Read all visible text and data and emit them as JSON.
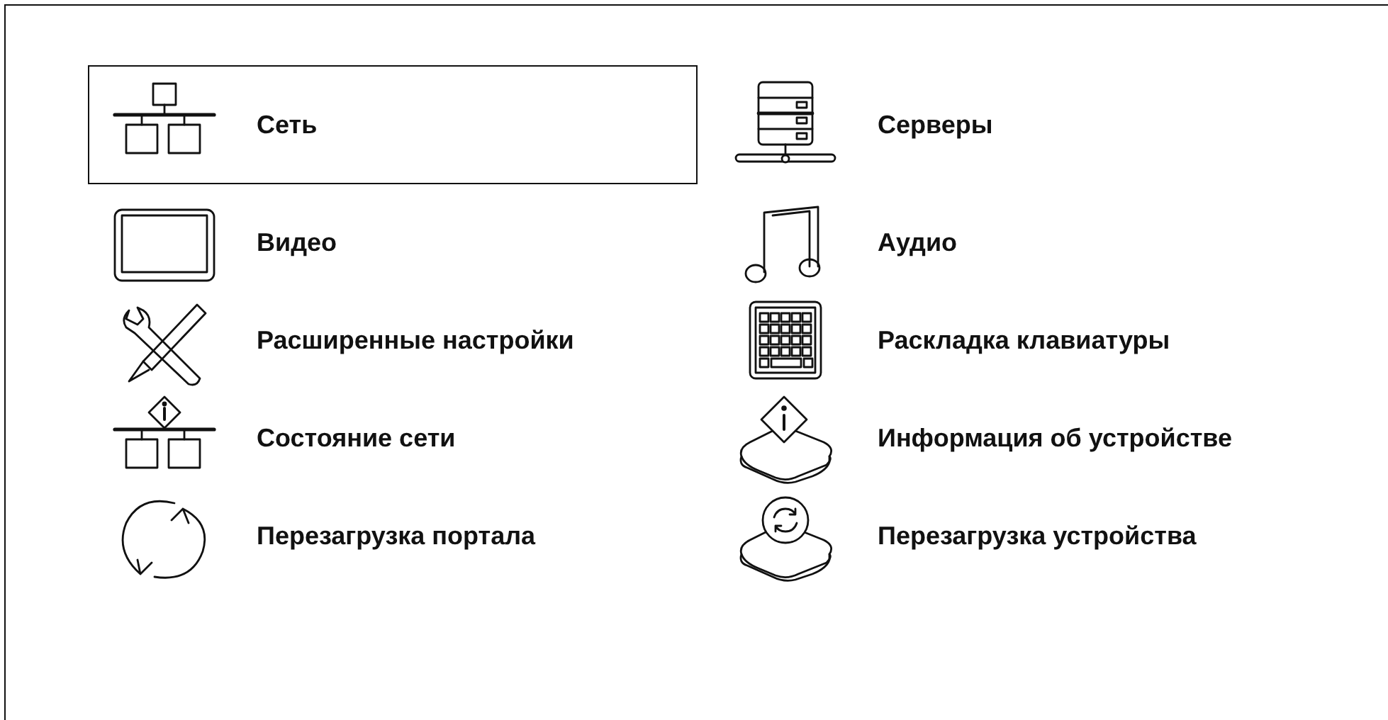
{
  "items": [
    {
      "label": "Сеть",
      "kind": "network",
      "selected": true
    },
    {
      "label": "Серверы",
      "kind": "servers",
      "selected": false
    },
    {
      "label": "Видео",
      "kind": "video",
      "selected": false
    },
    {
      "label": "Аудио",
      "kind": "audio",
      "selected": false
    },
    {
      "label": "Расширенные настройки",
      "kind": "tools",
      "selected": false
    },
    {
      "label": "Раскладка клавиатуры",
      "kind": "keyboard",
      "selected": false
    },
    {
      "label": "Состояние сети",
      "kind": "netstatus",
      "selected": false
    },
    {
      "label": "Информация об устройстве",
      "kind": "deviceinfo",
      "selected": false
    },
    {
      "label": "Перезагрузка портала",
      "kind": "reload",
      "selected": false
    },
    {
      "label": "Перезагрузка устройства",
      "kind": "devicereboot",
      "selected": false
    }
  ]
}
